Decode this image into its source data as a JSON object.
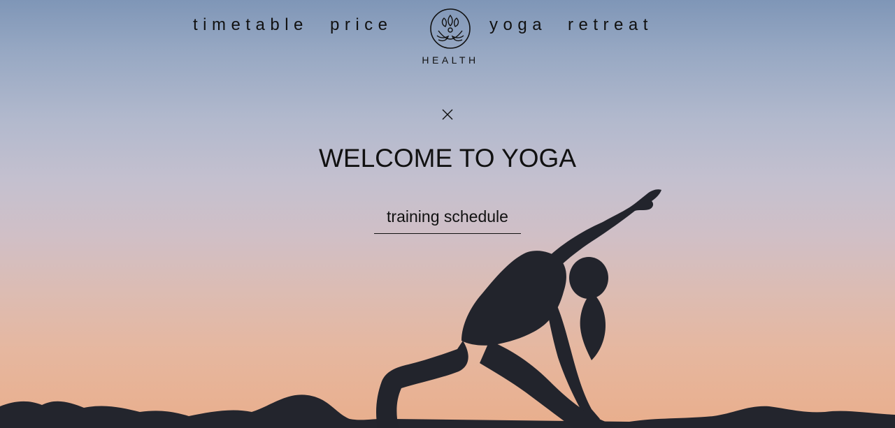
{
  "nav": {
    "timetable": "timetable",
    "price": "price",
    "yoga": "yoga",
    "retreat": "retreat"
  },
  "logo": {
    "text": "HEALTH",
    "icon": "lotus-icon"
  },
  "hero": {
    "title": "WELCOME TO YOGA",
    "cta_label": "training schedule",
    "close_icon": "close-icon",
    "background": "yoga silhouette at sunset"
  },
  "colors": {
    "text": "#111111",
    "sky_top": "#7f96b7",
    "sky_bottom": "#e9ae8c",
    "silhouette": "#22242c"
  }
}
